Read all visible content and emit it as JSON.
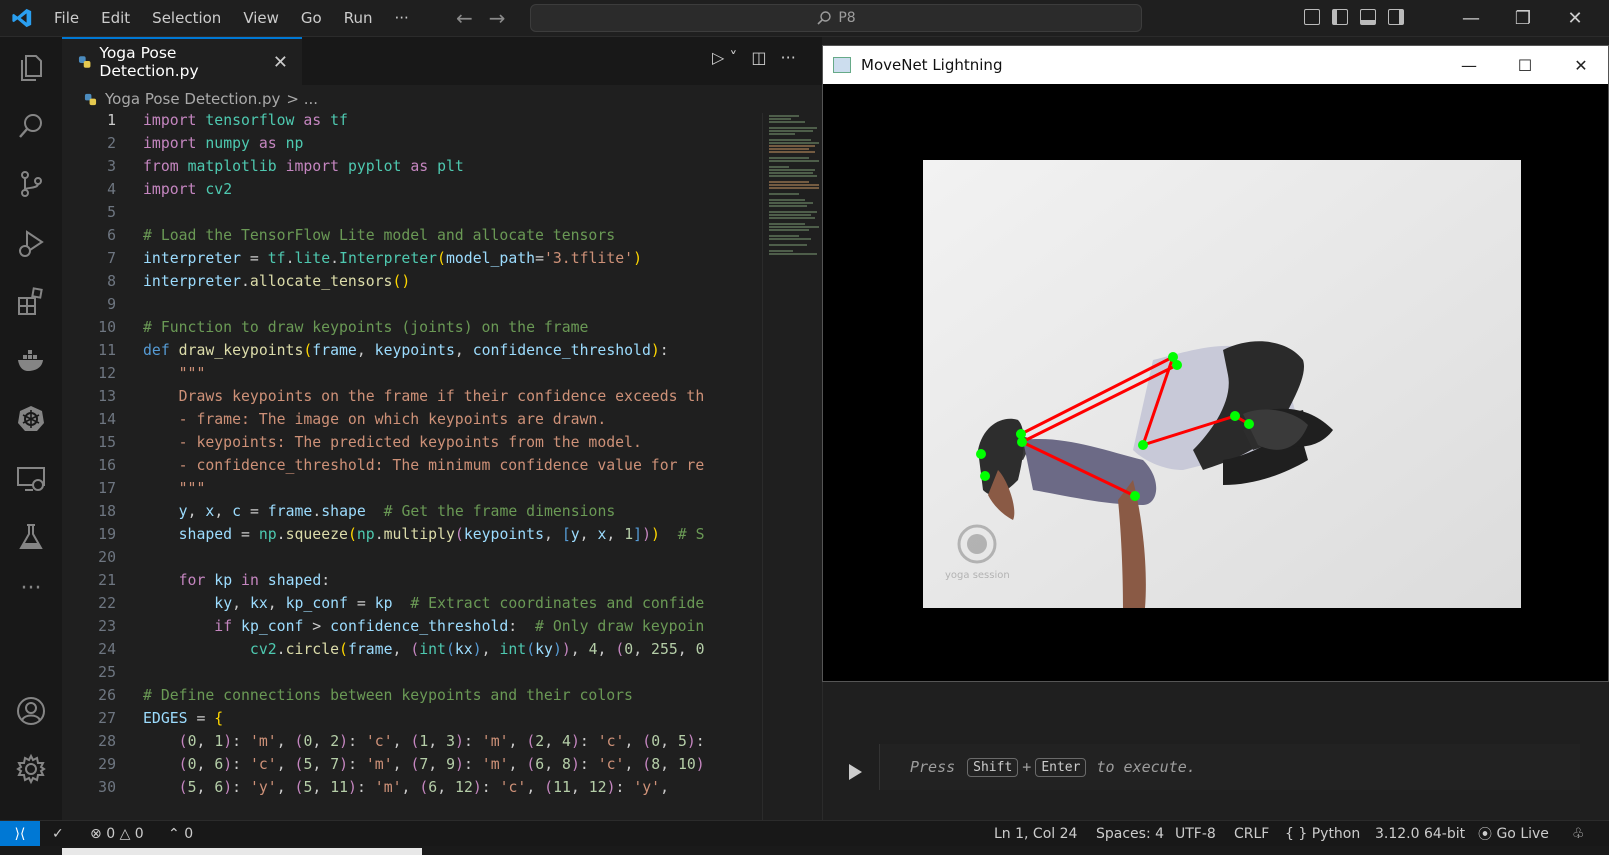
{
  "titlebar": {
    "menu": [
      "File",
      "Edit",
      "Selection",
      "View",
      "Go",
      "Run",
      "···"
    ],
    "search_text": "P8"
  },
  "tab": {
    "label": "Yoga Pose Detection.py"
  },
  "breadcrumb": {
    "file": "Yoga Pose Detection.py",
    "rest": "> ..."
  },
  "code_lines": [
    {
      "n": "1"
    },
    {
      "n": "2"
    },
    {
      "n": "3"
    },
    {
      "n": "4"
    },
    {
      "n": "5"
    },
    {
      "n": "6"
    },
    {
      "n": "7"
    },
    {
      "n": "8"
    },
    {
      "n": "9"
    },
    {
      "n": "10"
    },
    {
      "n": "11"
    },
    {
      "n": "12"
    },
    {
      "n": "13"
    },
    {
      "n": "14"
    },
    {
      "n": "15"
    },
    {
      "n": "16"
    },
    {
      "n": "17"
    },
    {
      "n": "18"
    },
    {
      "n": "19"
    },
    {
      "n": "20"
    },
    {
      "n": "21"
    },
    {
      "n": "22"
    },
    {
      "n": "23"
    },
    {
      "n": "24"
    },
    {
      "n": "25"
    },
    {
      "n": "26"
    },
    {
      "n": "27"
    },
    {
      "n": "28"
    },
    {
      "n": "29"
    },
    {
      "n": "30"
    }
  ],
  "code_text": [
    "import tensorflow as tf",
    "import numpy as np",
    "from matplotlib import pyplot as plt",
    "import cv2",
    "",
    "# Load the TensorFlow Lite model and allocate tensors",
    "interpreter = tf.lite.Interpreter(model_path='3.tflite')",
    "interpreter.allocate_tensors()",
    "",
    "# Function to draw keypoints (joints) on the frame",
    "def draw_keypoints(frame, keypoints, confidence_threshold):",
    "    \"\"\"",
    "    Draws keypoints on the frame if their confidence exceeds th",
    "    - frame: The image on which keypoints are drawn.",
    "    - keypoints: The predicted keypoints from the model.",
    "    - confidence_threshold: The minimum confidence value for re",
    "    \"\"\"",
    "    y, x, c = frame.shape  # Get the frame dimensions",
    "    shaped = np.squeeze(np.multiply(keypoints, [y, x, 1]))  # S",
    "",
    "    for kp in shaped:",
    "        ky, kx, kp_conf = kp  # Extract coordinates and confide",
    "        if kp_conf > confidence_threshold:  # Only draw keypoin",
    "            cv2.circle(frame, (int(kx), int(ky)), 4, (0, 255, 0",
    "",
    "# Define connections between keypoints and their colors",
    "EDGES = {",
    "    (0, 1): 'm', (0, 2): 'c', (1, 3): 'm', (2, 4): 'c', (0, 5):",
    "    (0, 6): 'c', (5, 7): 'm', (7, 9): 'm', (6, 8): 'c', (8, 10)",
    "    (5, 6): 'y', (5, 11): 'm', (6, 12): 'c', (11, 12): 'y',"
  ],
  "popup": {
    "title": "MoveNet Lightning",
    "watermark": "yoga session"
  },
  "exec": {
    "press": "Press",
    "shift": "Shift",
    "plus": "+",
    "enter": "Enter",
    "tail": "to execute."
  },
  "status": {
    "errors": "0",
    "warnings": "0",
    "ports": "0",
    "position": "Ln 1, Col 24",
    "spaces": "Spaces: 4",
    "encoding": "UTF-8",
    "eol": "CRLF",
    "language": "Python",
    "interpreter": "3.12.0 64-bit",
    "live": "Go Live"
  },
  "colors": {
    "accent": "#0078d4",
    "keypoint": "#00ff00",
    "edge": "#ff0000"
  }
}
